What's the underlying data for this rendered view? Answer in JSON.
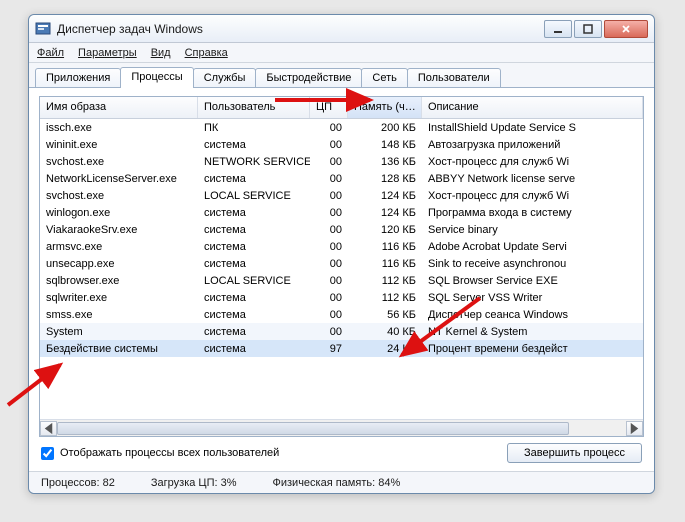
{
  "window": {
    "title": "Диспетчер задач Windows"
  },
  "menu": {
    "file": "Файл",
    "options": "Параметры",
    "view": "Вид",
    "help": "Справка"
  },
  "tabs": {
    "apps": "Приложения",
    "processes": "Процессы",
    "services": "Службы",
    "performance": "Быстродействие",
    "network": "Сеть",
    "users": "Пользователи"
  },
  "columns": {
    "image": "Имя образа",
    "user": "Пользователь",
    "cpu": "ЦП",
    "mem": "Память (ч…",
    "desc": "Описание"
  },
  "rows": [
    {
      "image": "issch.exe",
      "user": "ПК",
      "cpu": "00",
      "mem": "200 КБ",
      "desc": "InstallShield Update Service S"
    },
    {
      "image": "wininit.exe",
      "user": "система",
      "cpu": "00",
      "mem": "148 КБ",
      "desc": "Автозагрузка приложений"
    },
    {
      "image": "svchost.exe",
      "user": "NETWORK SERVICE",
      "cpu": "00",
      "mem": "136 КБ",
      "desc": "Хост-процесс для служб Wi"
    },
    {
      "image": "NetworkLicenseServer.exe",
      "user": "система",
      "cpu": "00",
      "mem": "128 КБ",
      "desc": "ABBYY Network license serve"
    },
    {
      "image": "svchost.exe",
      "user": "LOCAL SERVICE",
      "cpu": "00",
      "mem": "124 КБ",
      "desc": "Хост-процесс для служб Wi"
    },
    {
      "image": "winlogon.exe",
      "user": "система",
      "cpu": "00",
      "mem": "124 КБ",
      "desc": "Программа входа в систему"
    },
    {
      "image": "ViakaraokeSrv.exe",
      "user": "система",
      "cpu": "00",
      "mem": "120 КБ",
      "desc": "Service binary"
    },
    {
      "image": "armsvc.exe",
      "user": "система",
      "cpu": "00",
      "mem": "116 КБ",
      "desc": "Adobe Acrobat Update Servi"
    },
    {
      "image": "unsecapp.exe",
      "user": "система",
      "cpu": "00",
      "mem": "116 КБ",
      "desc": "Sink to receive asynchronou"
    },
    {
      "image": "sqlbrowser.exe",
      "user": "LOCAL SERVICE",
      "cpu": "00",
      "mem": "112 КБ",
      "desc": "SQL Browser Service EXE"
    },
    {
      "image": "sqlwriter.exe",
      "user": "система",
      "cpu": "00",
      "mem": "112 КБ",
      "desc": "SQL Server VSS Writer"
    },
    {
      "image": "smss.exe",
      "user": "система",
      "cpu": "00",
      "mem": "56 КБ",
      "desc": "Диспетчер сеанса  Windows"
    },
    {
      "image": "System",
      "user": "система",
      "cpu": "00",
      "mem": "40 КБ",
      "desc": "NT Kernel & System"
    },
    {
      "image": "Бездействие системы",
      "user": "система",
      "cpu": "97",
      "mem": "24 КБ",
      "desc": "Процент времени бездейст"
    }
  ],
  "checkboxLabel": "Отображать процессы всех пользователей",
  "endProcessLabel": "Завершить процесс",
  "status": {
    "procLabel": "Процессов:",
    "procVal": "82",
    "cpuLabel": "Загрузка ЦП:",
    "cpuVal": "3%",
    "memLabel": "Физическая память:",
    "memVal": "84%"
  }
}
